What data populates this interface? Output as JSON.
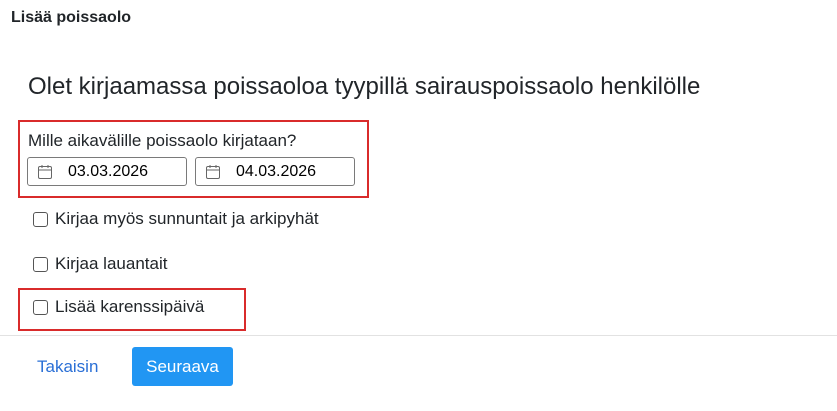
{
  "dialog": {
    "title": "Lisää poissaolo"
  },
  "main": {
    "heading": "Olet kirjaamassa poissaoloa tyypillä sairauspoissaolo henkilölle",
    "date_question": "Mille aikavälille poissaolo kirjataan?",
    "date_from": "03.03.2026",
    "date_to": "04.03.2026",
    "checkboxes": [
      {
        "label": "Kirjaa myös sunnuntait ja arkipyhät",
        "checked": false
      },
      {
        "label": "Kirjaa lauantait",
        "checked": false
      },
      {
        "label": "Lisää karenssipäivä",
        "checked": false
      }
    ]
  },
  "footer": {
    "back_label": "Takaisin",
    "next_label": "Seuraava"
  },
  "colors": {
    "primary": "#2196f3",
    "link": "#2a6fd6",
    "highlight": "#d92b2b"
  },
  "icons": {
    "date": "calendar-icon"
  }
}
